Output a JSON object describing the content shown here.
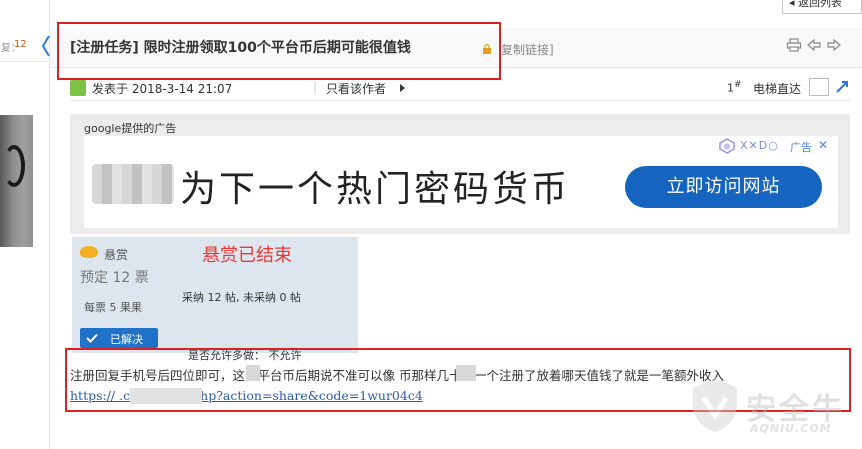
{
  "nav": {
    "back_label": "◂ 返回列表"
  },
  "sidebar": {
    "count_label": "复：",
    "count_value": "12"
  },
  "thread": {
    "title": "[注册任务] 限时注册领取100个平台币后期可能很值钱",
    "copy_link": "复制链接]"
  },
  "meta": {
    "posted_at": "发表于 2018-3-14 21:07",
    "separator": "|",
    "only_author": "只看该作者",
    "floor": "1",
    "floor_mark": "#",
    "elevator": "电梯直达"
  },
  "ad": {
    "provider": "google提供的广告",
    "headline": "为下一个热门密码货币",
    "cta": "立即访问网站",
    "choices_text": "X✕D○",
    "ad_label": "广告",
    "close": "✕"
  },
  "bounty": {
    "head": "悬赏",
    "predict": "预定 12 票",
    "each": "每票 5 果果",
    "solved": "已解决",
    "status": "悬赏已结束",
    "stats": "采纳 12 帖, 未采纳 0 帖",
    "allow_more": "是否允许多做： 不允许"
  },
  "post": {
    "text": "注册回复手机号后四位即可，这个平台币后期说不准可以像   币那样几十块一个注册了放着哪天值钱了就是一笔额外收入",
    "link": "https://          .com/index.php?action=share&code=1wur04c4"
  },
  "watermark": {
    "name": "安全牛",
    "sub": "AQNIU.COM"
  },
  "colors": {
    "highlight": "#e02020",
    "accent": "#1f72c7",
    "bounty_red": "#e53935",
    "link": "#2a5caa"
  }
}
